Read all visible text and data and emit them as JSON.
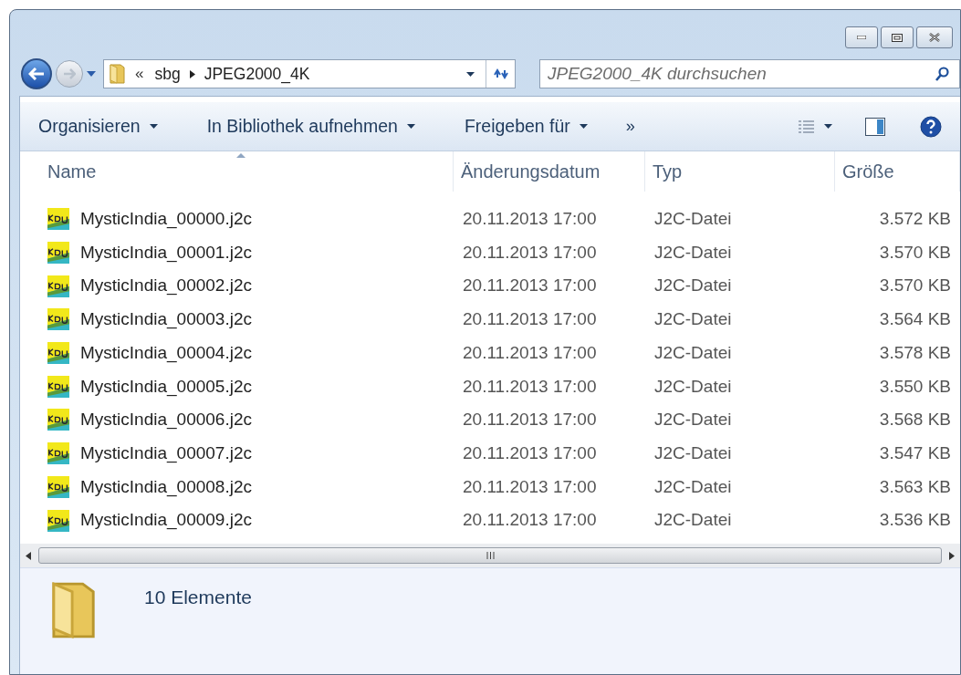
{
  "address": {
    "overflow": "«",
    "crumbs": [
      "sbg",
      "JPEG2000_4K"
    ]
  },
  "search": {
    "placeholder": "JPEG2000_4K durchsuchen"
  },
  "toolbar": {
    "items": [
      {
        "label": "Organisieren",
        "dropdown": true
      },
      {
        "label": "In Bibliothek aufnehmen",
        "dropdown": true
      },
      {
        "label": "Freigeben für",
        "dropdown": true
      }
    ],
    "more": "»"
  },
  "table": {
    "columns": [
      {
        "label": "Name",
        "sorted": true
      },
      {
        "label": "Änderungsdatum",
        "sorted": false
      },
      {
        "label": "Typ",
        "sorted": false
      },
      {
        "label": "Größe",
        "sorted": false
      }
    ],
    "rows": [
      {
        "name": "MysticIndia_00000.j2c",
        "date": "20.11.2013 17:00",
        "type": "J2C-Datei",
        "size": "3.572 KB"
      },
      {
        "name": "MysticIndia_00001.j2c",
        "date": "20.11.2013 17:00",
        "type": "J2C-Datei",
        "size": "3.570 KB"
      },
      {
        "name": "MysticIndia_00002.j2c",
        "date": "20.11.2013 17:00",
        "type": "J2C-Datei",
        "size": "3.570 KB"
      },
      {
        "name": "MysticIndia_00003.j2c",
        "date": "20.11.2013 17:00",
        "type": "J2C-Datei",
        "size": "3.564 KB"
      },
      {
        "name": "MysticIndia_00004.j2c",
        "date": "20.11.2013 17:00",
        "type": "J2C-Datei",
        "size": "3.578 KB"
      },
      {
        "name": "MysticIndia_00005.j2c",
        "date": "20.11.2013 17:00",
        "type": "J2C-Datei",
        "size": "3.550 KB"
      },
      {
        "name": "MysticIndia_00006.j2c",
        "date": "20.11.2013 17:00",
        "type": "J2C-Datei",
        "size": "3.568 KB"
      },
      {
        "name": "MysticIndia_00007.j2c",
        "date": "20.11.2013 17:00",
        "type": "J2C-Datei",
        "size": "3.547 KB"
      },
      {
        "name": "MysticIndia_00008.j2c",
        "date": "20.11.2013 17:00",
        "type": "J2C-Datei",
        "size": "3.563 KB"
      },
      {
        "name": "MysticIndia_00009.j2c",
        "date": "20.11.2013 17:00",
        "type": "J2C-Datei",
        "size": "3.536 KB"
      }
    ]
  },
  "details": {
    "summary": "10 Elemente"
  }
}
